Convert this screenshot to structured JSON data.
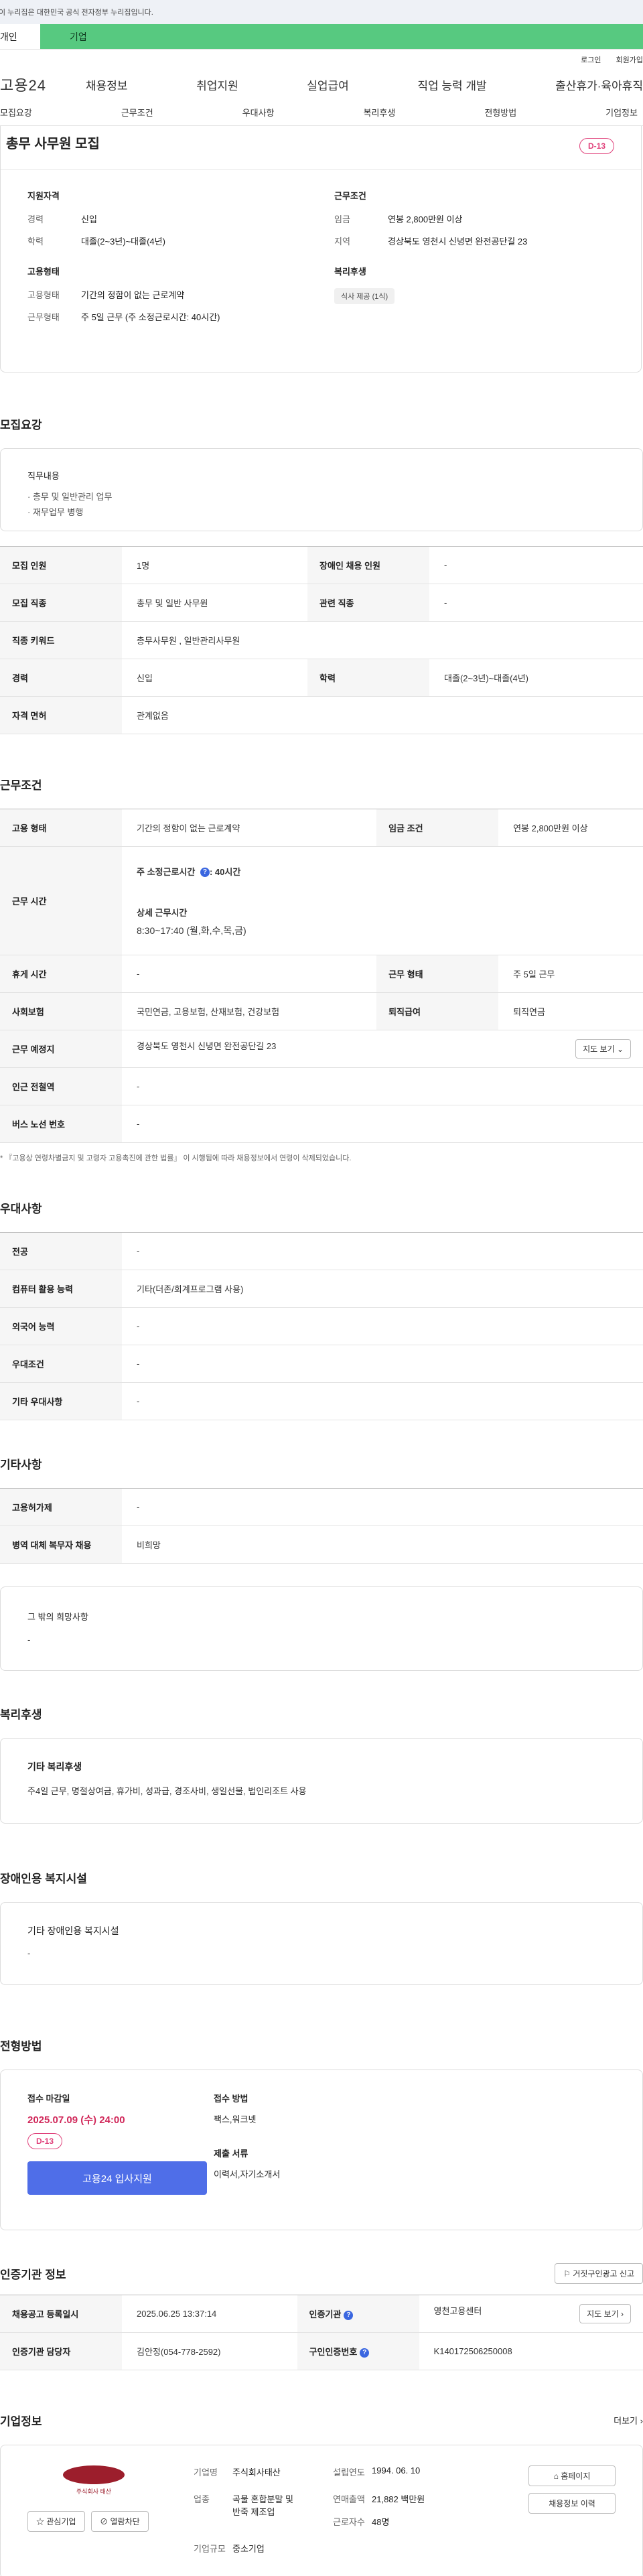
{
  "gov_banner": "이 누리집은 대한민국 공식 전자정부 누리집입니다.",
  "user_tabs": [
    "개인",
    "기업"
  ],
  "util_links": [
    "로그인",
    "회원가입"
  ],
  "logo": "고용24",
  "gnb": [
    "채용정보",
    "취업지원",
    "실업급여",
    "직업 능력 개발",
    "출산휴가·육아휴직"
  ],
  "lnb": [
    "모집요강",
    "근무조건",
    "우대사항",
    "복리후생",
    "전형방법",
    "기업정보"
  ],
  "summary": {
    "title": "총무 사무원 모집",
    "dday": "D-13",
    "qual_title": "지원자격",
    "career_k": "경력",
    "career_v": "신입",
    "edu_k": "학력",
    "edu_v": "대졸(2~3년)~대졸(4년)",
    "emp_title": "고용형태",
    "emptype_k": "고용형태",
    "emptype_v": "기간의 정함이 없는 근로계약",
    "worktype_k": "근무형태",
    "worktype_v": "주 5일 근무 (주 소정근로시간: 40시간)",
    "cond_title": "근무조건",
    "wage_k": "임금",
    "wage_v": "연봉 2,800만원 이상",
    "region_k": "지역",
    "region_v": "경상북도 영천시 신녕면 완전공단길 23",
    "welfare_title": "복리후생",
    "welfare_chip": "식사 제공 (1식)"
  },
  "recruit": {
    "heading": "모집요강",
    "duty_title": "직무내용",
    "duties": [
      "· 총무 및 일반관리 업무",
      "· 재무업무 병행"
    ],
    "rows": [
      [
        "모집 인원",
        "1명",
        "장애인 채용 인원",
        "-"
      ],
      [
        "모집 직종",
        "총무 및 일반 사무원",
        "관련 직종",
        "-"
      ],
      [
        "직종 키워드",
        "총무사무원 , 일반관리사무원"
      ],
      [
        "경력",
        "신입",
        "학력",
        "대졸(2~3년)~대졸(4년)"
      ],
      [
        "자격 면허",
        "관계없음"
      ]
    ]
  },
  "work": {
    "heading": "근무조건",
    "type_k": "고용 형태",
    "type_v": "기간의 정함이 없는 근로계약",
    "wage_k": "임금 조건",
    "wage_v": "연봉 2,800만원 이상",
    "time_k": "근무 시간",
    "time_week": "주 소정근로시간 ",
    "time_week_val": ": 40시간",
    "time_detail_title": "상세 근무시간",
    "time_detail": "8:30~17:40 (월,화,수,목,금)",
    "rest_k": "휴게 시간",
    "rest_v": "-",
    "form_k": "근무 형태",
    "form_v": "주 5일 근무",
    "ins_k": "사회보험",
    "ins_v": "국민연금, 고용보험, 산재보험, 건강보험",
    "sev_k": "퇴직급여",
    "sev_v": "퇴직연금",
    "place_k": "근무 예정지",
    "place_v": "경상북도 영천시 신녕면 완전공단길 23",
    "map_btn": "지도 보기",
    "station_k": "인근 전철역",
    "station_v": "-",
    "bus_k": "버스 노선 번호",
    "bus_v": "-",
    "note": "* 『고용상 연령차별금지 및 고령자 고용촉진에 관한 법률』 이 시행됨에 따라 채용정보에서 연령이 삭제되었습니다."
  },
  "prefer": {
    "heading": "우대사항",
    "rows": [
      [
        "전공",
        "-"
      ],
      [
        "컴퓨터 활용 능력",
        "기타(더존/회계프로그램 사용)"
      ],
      [
        "외국어 능력",
        "-"
      ],
      [
        "우대조건",
        "-"
      ],
      [
        "기타 우대사항",
        "-"
      ]
    ]
  },
  "etc": {
    "heading": "기타사항",
    "rows": [
      [
        "고용허가제",
        "-"
      ],
      [
        "병역 대체 복무자 채용",
        "비희망"
      ]
    ],
    "hope_title": "그 밖의 희망사항",
    "hope_v": "-"
  },
  "welfare": {
    "heading": "복리후생",
    "title": "기타 복리후생",
    "value": "주4일 근무, 명절상여금, 휴가비, 성과급, 경조사비, 생일선물, 법인리조트 사용"
  },
  "disabled": {
    "heading": "장애인용 복지시설",
    "title": "기타 장애인용 복지시설",
    "value": "-"
  },
  "select": {
    "heading": "전형방법",
    "deadline_title": "접수 마감일",
    "deadline": "2025.07.09 (수) 24:00",
    "dday": "D-13",
    "apply_btn": "고용24 입사지원",
    "method_title": "접수 방법",
    "method": "팩스,워크넷",
    "docs_title": "제출 서류",
    "docs": "이력서,자기소개서"
  },
  "agency": {
    "heading": "인증기관 정보",
    "report_btn": "거짓구인광고 신고",
    "reg_k": "채용공고 등록일시",
    "reg_v": "2025.06.25 13:37:14",
    "org_k": "인증기관",
    "org_v": "영천고용센터",
    "map_btn": "지도 보기",
    "mgr_k": "인증기관 담당자",
    "mgr_v": "김안정(054-778-2592)",
    "num_k": "구인인증번호",
    "num_v": "K140172506250008"
  },
  "company": {
    "heading": "기업정보",
    "more": "더보기",
    "logo_text": "주식회사 태산",
    "interest_btn": "관심기업",
    "recruit_btn": "열람차단",
    "name_k": "기업명",
    "name_v": "주식회사태산",
    "biz_k": "업종",
    "biz_v1": "곡물 혼합분말 및",
    "biz_v2": "반죽 제조업",
    "size_k": "기업규모",
    "size_v": "중소기업",
    "year_k": "설립연도",
    "year_v": "1994. 06. 10",
    "sales_k": "연매출액",
    "sales_v": "21,882 백만원",
    "staff_k": "근로자수",
    "staff_v": "48명",
    "home_btn": "홈페이지",
    "history_btn": "채용정보 이력"
  },
  "colors": {
    "accent": "#57c980",
    "primary": "#4f6ee8",
    "dday": "#e0407a"
  }
}
